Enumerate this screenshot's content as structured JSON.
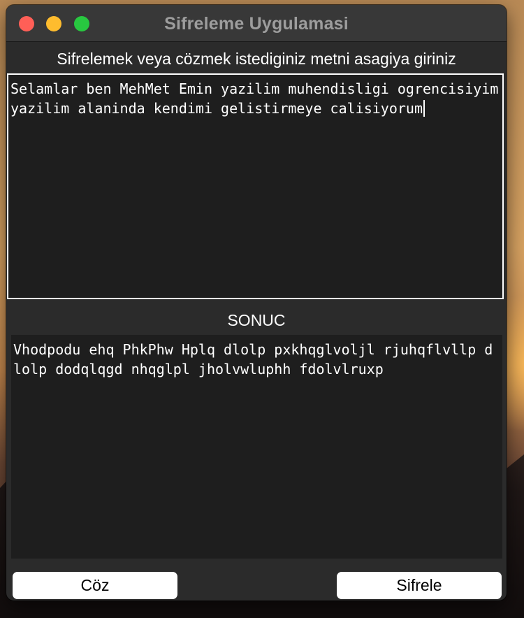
{
  "window": {
    "title": "Sifreleme Uygulamasi"
  },
  "colors": {
    "close": "#ff5f57",
    "minimize": "#febc2e",
    "zoom": "#28c840",
    "window_bg": "#2b2b2b",
    "textarea_bg": "#1e1e1e"
  },
  "icons": {
    "close": "close-traffic-light",
    "minimize": "minimize-traffic-light",
    "zoom": "zoom-traffic-light"
  },
  "main": {
    "prompt_label": "Sifrelemek veya cözmek istediginiz metni asagiya giriniz",
    "input_text": "Selamlar ben MehMet Emin yazilim muhendisligi ogrencisiyim yazilim alaninda kendimi gelistirmeye calisiyorum",
    "result_label": "SONUC",
    "output_text": "Vhodpodu ehq PhkPhw Hplq dlolp pxkhqglvoljl rjuhqflvllp dlolp dodqlqgd nhqglpl jholvwluphh fdolvlruxp"
  },
  "buttons": {
    "decode_label": "Cöz",
    "encode_label": "Sifrele"
  }
}
